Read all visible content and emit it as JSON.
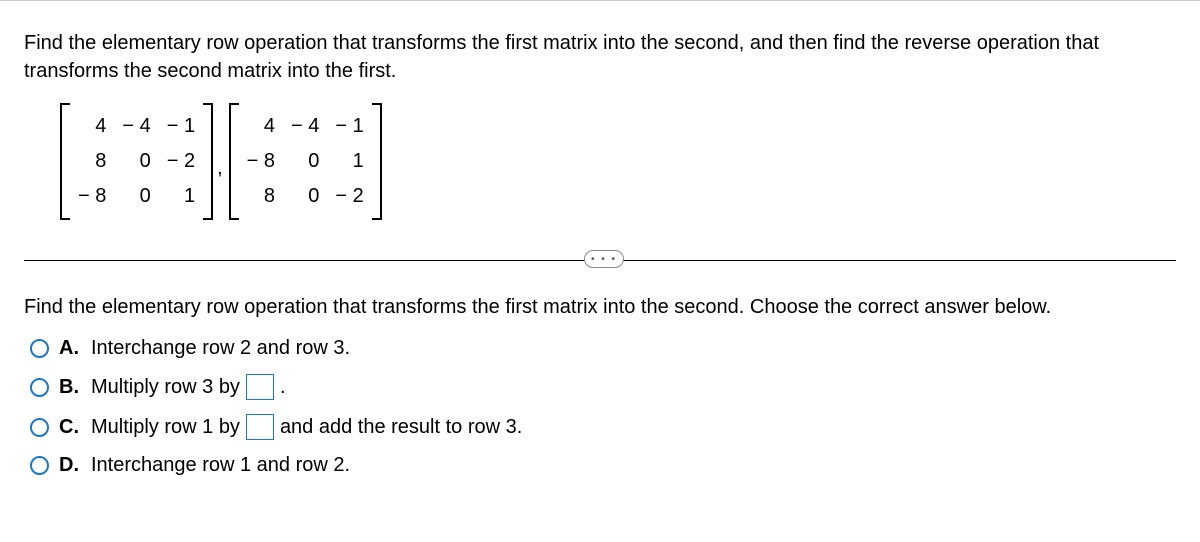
{
  "question": {
    "prompt": "Find the elementary row operation that transforms the first matrix into the second, and then find the reverse operation that transforms the second matrix into the first.",
    "matrix1": [
      [
        "4",
        "− 4",
        "− 1"
      ],
      [
        "8",
        "0",
        "− 2"
      ],
      [
        "− 8",
        "0",
        "1"
      ]
    ],
    "matrix2": [
      [
        "4",
        "− 4",
        "− 1"
      ],
      [
        "− 8",
        "0",
        "1"
      ],
      [
        "8",
        "0",
        "− 2"
      ]
    ],
    "separator": ",",
    "sub_prompt": "Find the elementary row operation that transforms the first matrix into the second. Choose the correct answer below."
  },
  "options": {
    "a": {
      "letter": "A.",
      "text": "Interchange row 2 and row 3."
    },
    "b": {
      "letter": "B.",
      "text_before": "Multiply row 3 by",
      "text_after": "."
    },
    "c": {
      "letter": "C.",
      "text_before": "Multiply row 1 by",
      "text_after": "and add the result to row 3."
    },
    "d": {
      "letter": "D.",
      "text": "Interchange row 1 and row 2."
    }
  },
  "ellipsis": "• • •"
}
